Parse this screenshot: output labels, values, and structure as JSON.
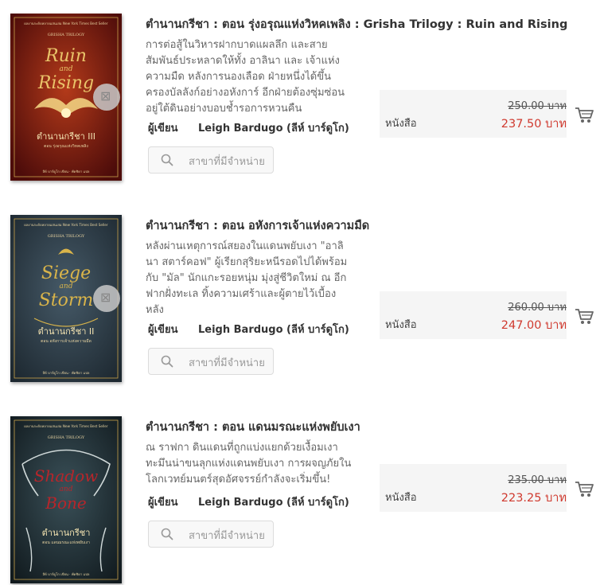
{
  "colors": {
    "price_red": "#d03a2f",
    "pricebox_bg": "#f5f5f5",
    "cover1_bg": "#6e1410",
    "cover2_bg": "#2d3b47",
    "cover3_bg": "#1b2a30"
  },
  "books": [
    {
      "title": "ตำนานกรีชา : ตอน รุ่งอรุณแห่งวิหคเพลิง : Grisha Trilogy : Ruin and Rising",
      "description_lines": [
        "การต่อสู้ในวิหารฝากบาดแผลลึก และสาย",
        "สัมพันธ์ประหลาดให้ทั้ง อาลินา และ เจ้าแห่ง",
        "ความมืด หลังการนองเลือด ฝ่ายหนึ่งได้ขึ้น",
        "ครองบัลลังก์อย่างอหังการ์ อีกฝ่ายต้องซุ่มซ่อน",
        "อยู่ใต้ดินอย่างบอบช้ำรอการหวนคืน"
      ],
      "author_label": "ผู้เขียน",
      "author": "Leigh Bardugo (ลีห์ บาร์ดูโก)",
      "product_type": "หนังสือ",
      "old_price": "250.00 บาท",
      "price": "237.50 บาท",
      "store_button": "สาขาที่มีจำหน่าย",
      "cover_text": {
        "top": "ผลงานระดับหลายแสนเล่ม New York Times Best Seller",
        "series": "GRISHA TRILOGY",
        "word1": "Ruin",
        "word2": "and",
        "word3": "Rising",
        "thai": "ตำนานกรีชา III",
        "subtitle": "ตอน รุ่งอรุณแห่งวิหคเพลิง",
        "credits": "ลีห์ บาร์ดูโก เขียน · พัดชิดา แปล"
      }
    },
    {
      "title": "ตำนานกรีชา : ตอน อหังการเจ้าแห่งความมืด",
      "description_lines": [
        "หลังผ่านเหตุการณ์สยองในแดนพยับเงา \"อาลิ",
        "นา สตาร์คอฟ\" ผู้เรียกสุริยะหนีรอดไปได้พร้อม",
        "กับ \"มัล\" นักแกะรอยหนุ่ม มุ่งสู่ชีวิตใหม่ ณ อีก",
        "ฟากฝั่งทะเล ทิ้งความเศร้าและผู้ตายไว้เบื้อง",
        "หลัง"
      ],
      "author_label": "ผู้เขียน",
      "author": "Leigh Bardugo (ลีห์ บาร์ดูโก)",
      "product_type": "หนังสือ",
      "old_price": "260.00 บาท",
      "price": "247.00 บาท",
      "store_button": "สาขาที่มีจำหน่าย",
      "cover_text": {
        "top": "ผลงานระดับหลายแสนเล่ม New York Times Best Seller",
        "series": "GRISHA TRILOGY",
        "word1": "Siege",
        "word2": "and",
        "word3": "Storm",
        "thai": "ตำนานกรีชา II",
        "subtitle": "ตอน อหังการเจ้าแห่งความมืด",
        "credits": "ลีห์ บาร์ดูโก เขียน · พัดชิดา แปล"
      }
    },
    {
      "title": "ตำนานกรีชา : ตอน แดนมรณะแห่งพยับเงา",
      "description_lines": [
        "ณ ราฟกา ดินแดนที่ถูกแบ่งแยกด้วยเงื้อมเงา",
        "ทะมึนน่าขนลุกแห่งแดนพยับเงา การผจญภัยใน",
        "โลกเวทย์มนตร์สุดอัศจรรย์กำลังจะเริ่มขึ้น!"
      ],
      "author_label": "ผู้เขียน",
      "author": "Leigh Bardugo (ลีห์ บาร์ดูโก)",
      "product_type": "หนังสือ",
      "old_price": "235.00 บาท",
      "price": "223.25 บาท",
      "store_button": "สาขาที่มีจำหน่าย",
      "cover_text": {
        "top": "ผลงานระดับหลายแสนเล่ม New York Times Best Seller",
        "series": "GRISHA TRILOGY",
        "word1": "Shadow",
        "word2": "and",
        "word3": "Bone",
        "thai": "ตำนานกรีชา",
        "subtitle": "ตอน แดนมรณะแห่งพยับเงา",
        "credits": "ลีห์ บาร์ดูโก เขียน · พัดชิดา แปล"
      }
    }
  ]
}
